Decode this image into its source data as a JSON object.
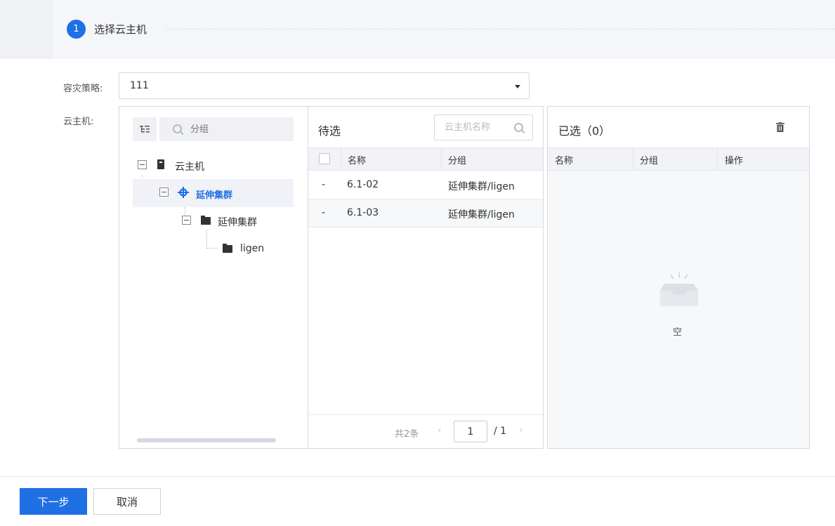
{
  "step": {
    "number": "1",
    "title": "选择云主机"
  },
  "form": {
    "policy_label": "容灾策略:",
    "policy_value": "111",
    "host_label": "云主机:"
  },
  "tree": {
    "search_placeholder": "分组",
    "nodes": [
      {
        "label": "云主机"
      },
      {
        "label": "延伸集群"
      },
      {
        "label": "延伸集群"
      },
      {
        "label": "ligen"
      }
    ]
  },
  "candidates": {
    "title": "待选",
    "search_placeholder": "云主机名称",
    "columns": [
      "名称",
      "分组"
    ],
    "rows": [
      {
        "state": "-",
        "name": "6.1-02",
        "group": "延伸集群/ligen"
      },
      {
        "state": "-",
        "name": "6.1-03",
        "group": "延伸集群/ligen"
      }
    ],
    "pager": {
      "total": "共2条",
      "prev": "‹",
      "current": "1",
      "pages": "/ 1",
      "next": "›"
    }
  },
  "selected": {
    "title": "已选（0）",
    "columns": [
      "名称",
      "分组",
      "操作"
    ],
    "empty_text": "空"
  },
  "footer": {
    "next_label": "下一步",
    "cancel_label": "取消"
  },
  "colors": {
    "primary": "#1f6fe5"
  }
}
